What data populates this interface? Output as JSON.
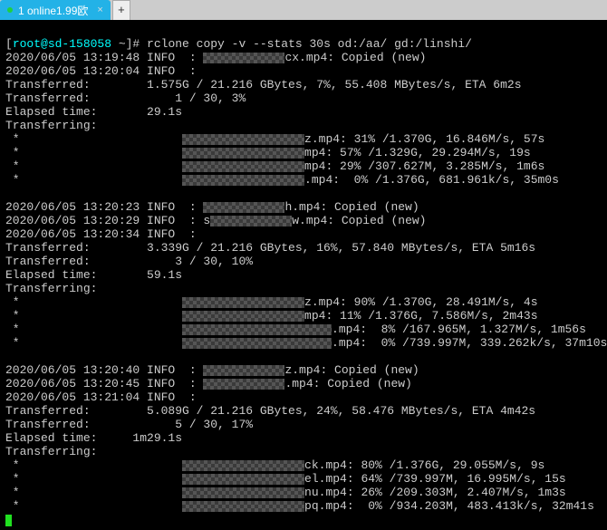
{
  "tab": {
    "dot": "●",
    "label": "1 online1.99欧",
    "close": "×",
    "add": "+"
  },
  "prompt": {
    "user_host": "root@sd-158058",
    "sep": " ~]# ",
    "cmd": "rclone copy -v --stats 30s od:/aa/ gd:/linshi/"
  },
  "block1": {
    "l1_ts": "2020/06/05 13:19:48 INFO  : ",
    "l1_ext": "cx.mp4: Copied (new)",
    "l2_ts": "2020/06/05 13:20:04 INFO  :",
    "xfer_bytes": "Transferred:        1.575G / 21.216 GBytes, 7%, 55.408 MBytes/s, ETA 6m2s",
    "xfer_count": "Transferred:            1 / 30, 3%",
    "elapsed": "Elapsed time:       29.1s",
    "transferring": "Transferring:",
    "t1_pre": " *                       ",
    "t1_post": "z.mp4: 31% /1.370G, 16.846M/s, 57s",
    "t2_pre": " *                       ",
    "t2_post": "mp4: 57% /1.329G, 29.294M/s, 19s",
    "t3_pre": " *                       ",
    "t3_post": "mp4: 29% /307.627M, 3.285M/s, 1m6s",
    "t4_pre": " *                       ",
    "t4_post": ".mp4:  0% /1.376G, 681.961k/s, 35m0s"
  },
  "block2": {
    "l1_ts": "2020/06/05 13:20:23 INFO  : ",
    "l1_ext": "h.mp4: Copied (new)",
    "l2_ts": "2020/06/05 13:20:29 INFO  : s",
    "l2_ext": "w.mp4: Copied (new)",
    "l3_ts": "2020/06/05 13:20:34 INFO  :",
    "xfer_bytes": "Transferred:        3.339G / 21.216 GBytes, 16%, 57.840 MBytes/s, ETA 5m16s",
    "xfer_count": "Transferred:            3 / 30, 10%",
    "elapsed": "Elapsed time:       59.1s",
    "transferring": "Transferring:",
    "t1_pre": " *                       ",
    "t1_post": "z.mp4: 90% /1.370G, 28.491M/s, 4s",
    "t2_pre": " *                       ",
    "t2_post": "mp4: 11% /1.376G, 7.586M/s, 2m43s",
    "t3_pre": " *                       ",
    "t3_post": ".mp4:  8% /167.965M, 1.327M/s, 1m56s",
    "t4_pre": " *                       ",
    "t4_post": ".mp4:  0% /739.997M, 339.262k/s, 37m10s"
  },
  "block3": {
    "l1_ts": "2020/06/05 13:20:40 INFO  : ",
    "l1_ext": "z.mp4: Copied (new)",
    "l2_ts": "2020/06/05 13:20:45 INFO  : ",
    "l2_ext": ".mp4: Copied (new)",
    "l3_ts": "2020/06/05 13:21:04 INFO  :",
    "xfer_bytes": "Transferred:        5.089G / 21.216 GBytes, 24%, 58.476 MBytes/s, ETA 4m42s",
    "xfer_count": "Transferred:            5 / 30, 17%",
    "elapsed": "Elapsed time:     1m29.1s",
    "transferring": "Transferring:",
    "t1_pre": " *                       ",
    "t1_post": "ck.mp4: 80% /1.376G, 29.055M/s, 9s",
    "t2_pre": " *                       ",
    "t2_post": "el.mp4: 64% /739.997M, 16.995M/s, 15s",
    "t3_pre": " *                       ",
    "t3_post": "nu.mp4: 26% /209.303M, 2.407M/s, 1m3s",
    "t4_pre": " *                       ",
    "t4_post": "pq.mp4:  0% /934.203M, 483.413k/s, 32m41s"
  }
}
